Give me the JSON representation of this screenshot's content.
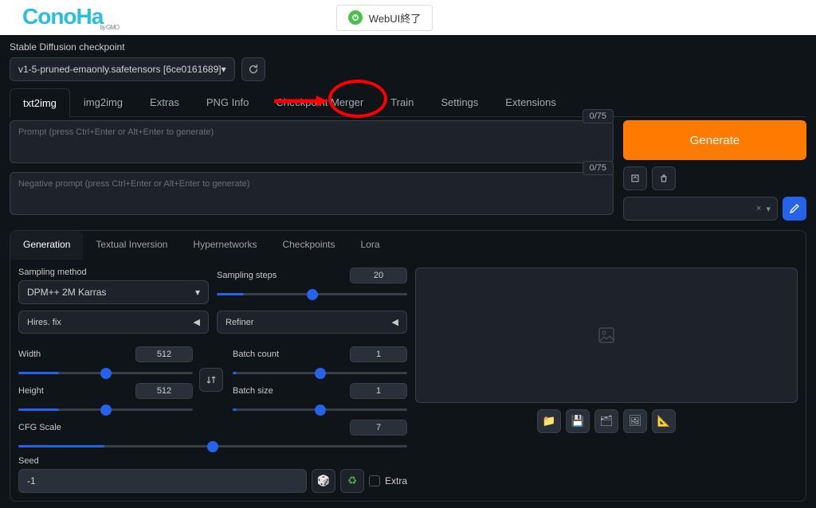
{
  "header": {
    "logo_text": "ConoHa",
    "logo_sub": "by GMO",
    "shutdown_label": "WebUI終了"
  },
  "checkpoint": {
    "label": "Stable Diffusion checkpoint",
    "value": "v1-5-pruned-emaonly.safetensors [6ce0161689]"
  },
  "tabs": [
    "txt2img",
    "img2img",
    "Extras",
    "PNG Info",
    "Checkpoint Merger",
    "Train",
    "Settings",
    "Extensions"
  ],
  "active_tab": "txt2img",
  "prompt": {
    "placeholder": "Prompt (press Ctrl+Enter or Alt+Enter to generate)",
    "counter": "0/75"
  },
  "neg_prompt": {
    "placeholder": "Negative prompt (press Ctrl+Enter or Alt+Enter to generate)",
    "counter": "0/75"
  },
  "generate_label": "Generate",
  "style_close": "×",
  "subtabs": [
    "Generation",
    "Textual Inversion",
    "Hypernetworks",
    "Checkpoints",
    "Lora"
  ],
  "active_subtab": "Generation",
  "gen": {
    "sampling_method_label": "Sampling method",
    "sampling_method_value": "DPM++ 2M Karras",
    "sampling_steps_label": "Sampling steps",
    "sampling_steps_value": "20",
    "hires_label": "Hires. fix",
    "refiner_label": "Refiner",
    "width_label": "Width",
    "width_value": "512",
    "height_label": "Height",
    "height_value": "512",
    "batch_count_label": "Batch count",
    "batch_count_value": "1",
    "batch_size_label": "Batch size",
    "batch_size_value": "1",
    "cfg_label": "CFG Scale",
    "cfg_value": "7",
    "seed_label": "Seed",
    "seed_value": "-1",
    "extra_label": "Extra"
  }
}
